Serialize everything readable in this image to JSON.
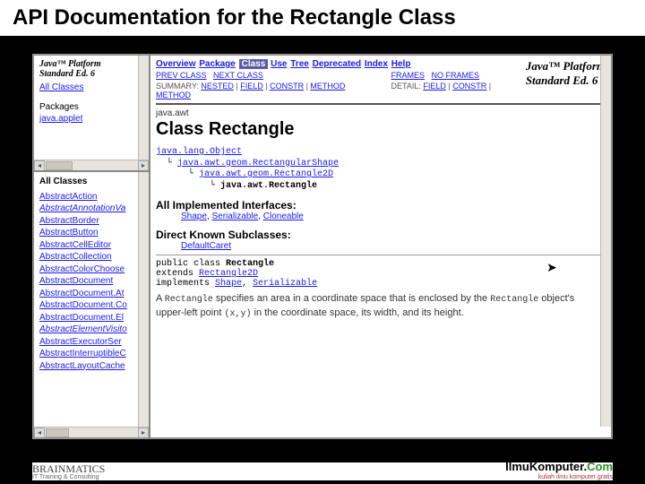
{
  "slide": {
    "title": "API Documentation for the Rectangle Class"
  },
  "leftTop": {
    "platform1": "Java™ Platform",
    "platform2": "Standard Ed. 6",
    "allClasses": "All Classes",
    "packagesLabel": "Packages",
    "package1": "java.applet"
  },
  "leftBottom": {
    "header": "All Classes",
    "items": [
      "AbstractAction",
      "AbstractAnnotationVa",
      "AbstractBorder",
      "AbstractButton",
      "AbstractCellEditor",
      "AbstractCollection",
      "AbstractColorChoose",
      "AbstractDocument",
      "AbstractDocument.At",
      "AbstractDocument.Co",
      "AbstractDocument.El",
      "AbstractElementVisito",
      "AbstractExecutorSer",
      "AbstractInterruptibleC",
      "AbstractLayoutCache"
    ]
  },
  "nav": {
    "items": [
      "Overview",
      "Package",
      "Class",
      "Use",
      "Tree",
      "Deprecated",
      "Index",
      "Help"
    ],
    "platform1": "Java™ Platform",
    "platform2": "Standard Ed. 6",
    "row2": {
      "prev": "PREV CLASS",
      "next": "NEXT CLASS",
      "frames": "FRAMES",
      "noframes": "NO FRAMES"
    },
    "row3": {
      "summaryLabel": "SUMMARY:",
      "summary": [
        "NESTED",
        "FIELD",
        "CONSTR",
        "METHOD"
      ],
      "detailLabel": "DETAIL:",
      "detail": [
        "FIELD",
        "CONSTR",
        "METHOD"
      ]
    }
  },
  "main": {
    "packageName": "java.awt",
    "classTitle": "Class Rectangle",
    "tree": [
      "java.lang.Object",
      "java.awt.geom.RectangularShape",
      "java.awt.geom.Rectangle2D",
      "java.awt.Rectangle"
    ],
    "implHeader": "All Implemented Interfaces:",
    "implList": [
      "Shape",
      "Serializable",
      "Cloneable"
    ],
    "subHeader": "Direct Known Subclasses:",
    "subList": [
      "DefaultCaret"
    ],
    "decl": {
      "l1a": "public class ",
      "l1b": "Rectangle",
      "l2a": "extends ",
      "l2b": "Rectangle2D",
      "l3a": "implements ",
      "l3b": "Shape",
      "l3c": "Serializable"
    },
    "desc": {
      "t1": "A ",
      "c1": "Rectangle",
      "t2": " specifies an area in a coordinate space that is enclosed by the ",
      "c2": "Rectangle",
      "t3": " object's upper-left point ",
      "c3": "(x,y)",
      "t4": " in the coordinate space, its width, and its height."
    }
  },
  "footer": {
    "leftBrand": "BRAINMATICS",
    "leftSub": "IT Training & Consulting",
    "rightBrand1": "IlmuKomputer.",
    "rightBrand2": "Com",
    "rightSub": "kuliah ilmu komputer gratis"
  }
}
